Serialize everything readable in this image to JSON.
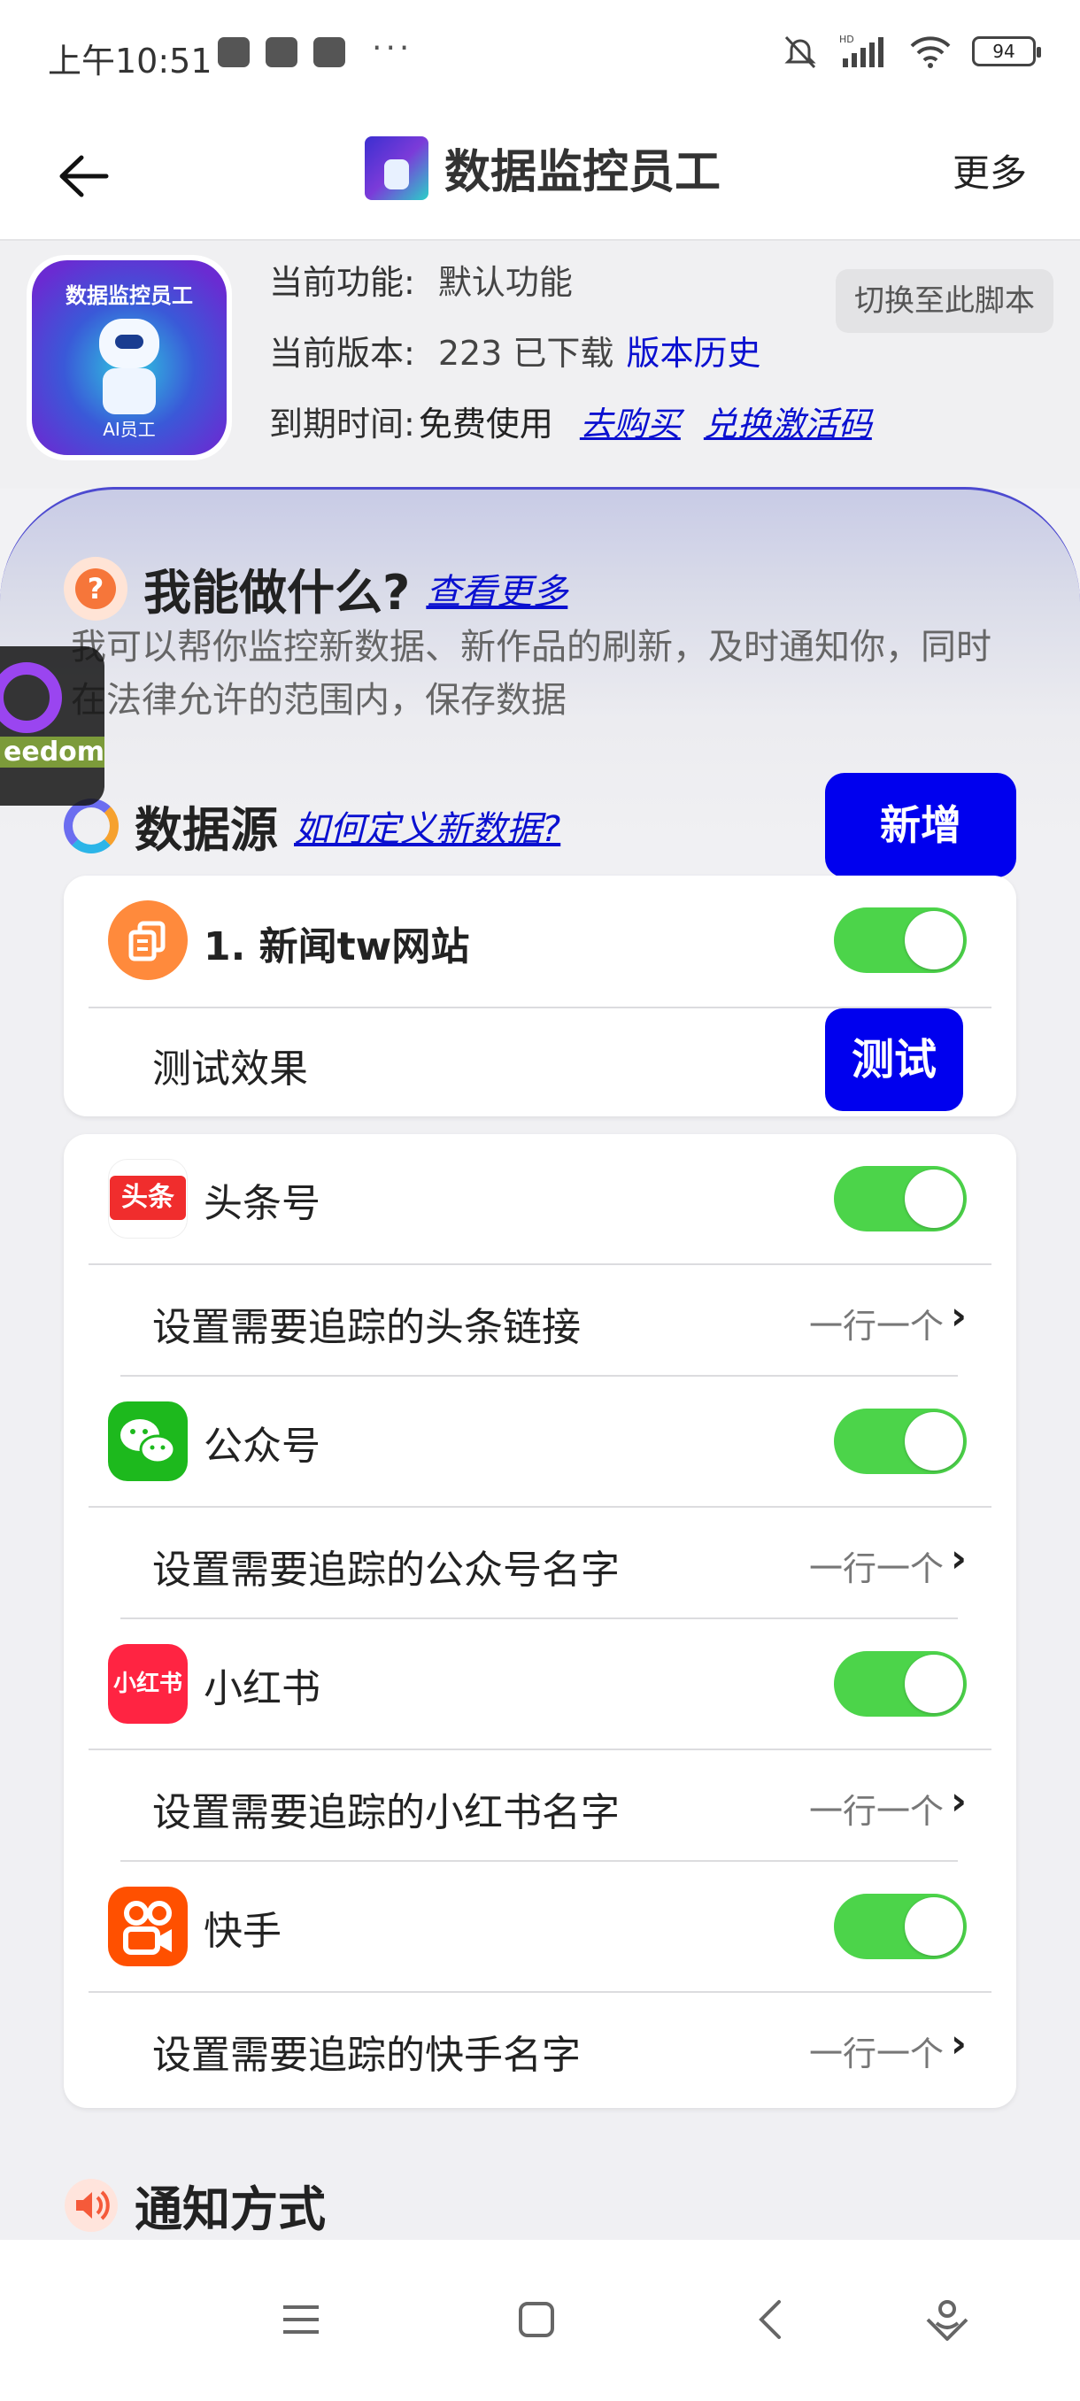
{
  "status": {
    "time": "上午10:51",
    "more_dots": "···",
    "battery": "94"
  },
  "header": {
    "title": "数据监控员工",
    "more": "更多"
  },
  "app": {
    "icon_title": "数据监控员工",
    "icon_caption": "AI员工",
    "current_function_label": "当前功能:",
    "current_function_value": "默认功能",
    "switch_button": "切换至此脚本",
    "version_label": "当前版本:",
    "version_value": "223 已下载",
    "version_history": "版本历史",
    "expiry_label": "到期时间:",
    "expiry_value": "免费使用",
    "buy_link": "去购买",
    "redeem_link": "兑换激活码"
  },
  "can_do": {
    "title": "我能做什么?",
    "link": "查看更多",
    "description": "我可以帮你监控新数据、新作品的刷新，及时通知你，同时在法律允许的范围内，保存数据"
  },
  "floating": {
    "label": "eedom"
  },
  "data_source": {
    "title": "数据源",
    "link": "如何定义新数据?",
    "add_button": "新增",
    "custom": {
      "name": "1. 新闻tw网站",
      "enabled": true,
      "test_label": "测试效果",
      "test_button": "测试"
    },
    "platforms": [
      {
        "icon_text": "头条",
        "icon": "toutiao-icon",
        "color": "#f02d2d",
        "name": "头条号",
        "enabled": true,
        "setting": "设置需要追踪的头条链接",
        "hint": "一行一个"
      },
      {
        "icon_text": "",
        "icon": "wechat-icon",
        "color": "#1db91d",
        "name": "公众号",
        "enabled": true,
        "setting": "设置需要追踪的公众号名字",
        "hint": "一行一个"
      },
      {
        "icon_text": "小红书",
        "icon": "xiaohongshu-icon",
        "color": "#ff2442",
        "name": "小红书",
        "enabled": true,
        "setting": "设置需要追踪的小红书名字",
        "hint": "一行一个"
      },
      {
        "icon_text": "",
        "icon": "kuaishou-icon",
        "color": "#ff5000",
        "name": "快手",
        "enabled": true,
        "setting": "设置需要追踪的快手名字",
        "hint": "一行一个"
      }
    ]
  },
  "notify": {
    "title": "通知方式"
  },
  "colors": {
    "accent": "#0000ee",
    "toggle_on": "#4cd44a",
    "link": "#0a10d0"
  }
}
